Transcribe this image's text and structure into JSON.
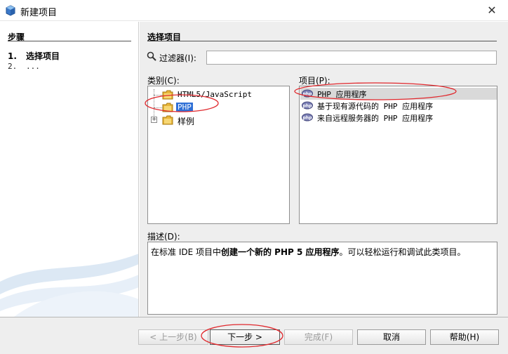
{
  "window": {
    "title": "新建项目",
    "close_glyph": "✕"
  },
  "sidebar": {
    "title": "步骤",
    "steps": [
      {
        "num": "1.",
        "label": "选择项目"
      },
      {
        "num": "2.",
        "label": "..."
      }
    ]
  },
  "main": {
    "title": "选择项目",
    "filter": {
      "label": "过滤器(I):",
      "value": ""
    },
    "categories": {
      "label": "类别(C):",
      "items": [
        "HTML5/JavaScript",
        "PHP",
        "样例"
      ],
      "selected": "PHP"
    },
    "projects": {
      "label": "项目(P):",
      "items": [
        "PHP 应用程序",
        "基于现有源代码的 PHP 应用程序",
        "来自远程服务器的 PHP 应用程序"
      ],
      "selected": "PHP 应用程序"
    },
    "description": {
      "label": "描述(D):",
      "prefix": "在标准 IDE 项目中",
      "bold": "创建一个新的 PHP 5 应用程序",
      "suffix": "。可以轻松运行和调试此类项目。"
    }
  },
  "buttons": {
    "back": "< 上一步(B)",
    "next": "下一步 >",
    "finish": "完成(F)",
    "cancel": "取消",
    "help": "帮助(H)"
  },
  "colors": {
    "selection": "#2f6fd6",
    "annotation": "#e0282d"
  }
}
